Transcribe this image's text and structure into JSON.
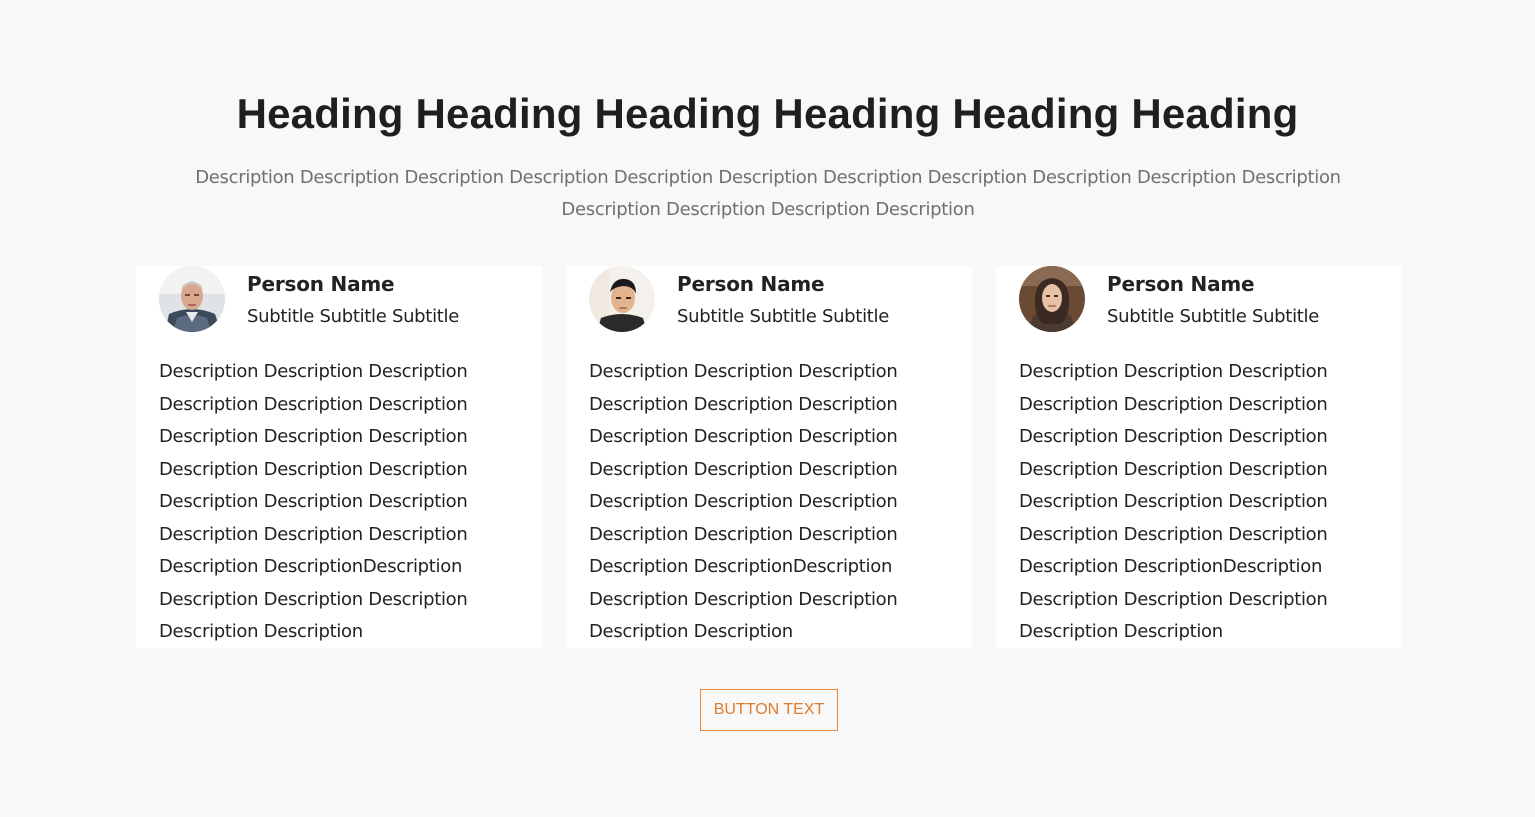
{
  "header": {
    "title": "Heading Heading Heading Heading Heading Heading",
    "description": "Description Description Description Description Description Description Description Description Description Description Description Description Description Description Description"
  },
  "cards": [
    {
      "name": "Person Name",
      "subtitle": "Subtitle Subtitle Subtitle",
      "description": "Description Description Description\nDescription Description Description\nDescription Description Description\nDescription Description Description\nDescription Description Description\nDescription Description Description\nDescription DescriptionDescription\nDescription Description Description\nDescription Description"
    },
    {
      "name": "Person Name",
      "subtitle": "Subtitle Subtitle Subtitle",
      "description": "Description Description Description\nDescription Description Description\nDescription Description Description\nDescription Description Description\nDescription Description Description\nDescription Description Description\nDescription DescriptionDescription\nDescription Description Description\nDescription Description"
    },
    {
      "name": "Person Name",
      "subtitle": "Subtitle Subtitle Subtitle",
      "description": "Description Description Description\nDescription Description Description\nDescription Description Description\nDescription Description Description\nDescription Description Description\nDescription Description Description\nDescription DescriptionDescription\nDescription Description Description\nDescription Description"
    }
  ],
  "button": {
    "label": "BUTTON TEXT"
  },
  "colors": {
    "background": "#f8f8f8",
    "card": "#ffffff",
    "accent": "#e8893a",
    "heading": "#1f1f1f",
    "muted": "#707070"
  }
}
